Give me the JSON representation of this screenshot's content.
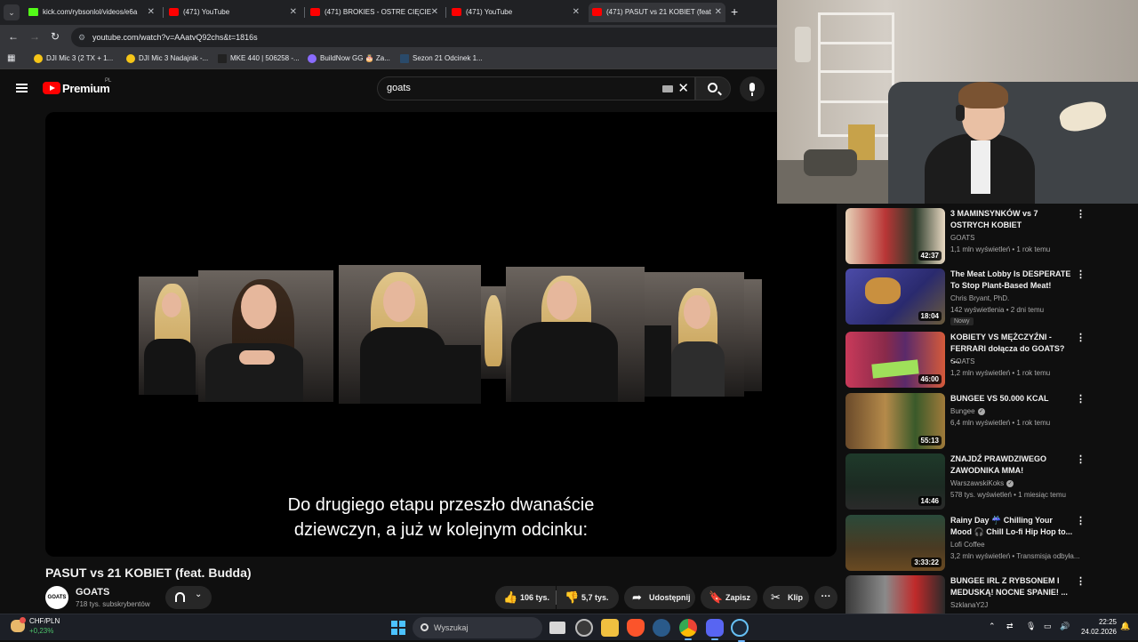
{
  "browser": {
    "tabs": [
      {
        "title": "kick.com/rybsonlol/videos/e6a",
        "favicon": "kick-icon",
        "active": false
      },
      {
        "title": "(471) YouTube",
        "favicon": "youtube-icon",
        "active": false
      },
      {
        "title": "(471) BROKIES - OSTRE CIĘCIE",
        "favicon": "youtube-icon",
        "active": false
      },
      {
        "title": "(471) YouTube",
        "favicon": "youtube-icon",
        "active": false
      },
      {
        "title": "(471) PASUT vs 21 KOBIET (feat",
        "favicon": "youtube-icon",
        "active": true
      }
    ],
    "url": "youtube.com/watch?v=AAatvQ92chs&t=1816s",
    "bookmarks": [
      {
        "label": "DJI Mic 3 (2 TX + 1...",
        "color": "#f5c518"
      },
      {
        "label": "DJI Mic 3 Nadajnik -...",
        "color": "#f5c518"
      },
      {
        "label": "MKE 440 | 506258 -...",
        "color": "#222222"
      },
      {
        "label": "BuildNow GG 🎂 Za...",
        "color": "#8a6cff"
      },
      {
        "label": "Sezon 21 Odcinek 1...",
        "color": "#2a4a6a"
      }
    ]
  },
  "youtube": {
    "brand": "Premium",
    "region": "PL",
    "search_query": "goats"
  },
  "video": {
    "subtitle_line1": "Do drugiego etapu przeszło dwanaście",
    "subtitle_line2": "dziewczyn, a już w kolejnym odcinku:",
    "title": "PASUT vs 21 KOBIET (feat. Budda)",
    "channel": {
      "name": "GOATS",
      "avatar_text": "GOATS",
      "subscribers": "718 tys. subskrybentów"
    },
    "actions": {
      "likes": "106 tys.",
      "dislikes": "5,7 tys.",
      "share": "Udostępnij",
      "save": "Zapisz",
      "clip": "Klip"
    }
  },
  "recommendations": [
    {
      "title": "3 MAMINSYNKÓW vs 7 OSTRYCH KOBIET",
      "channel": "GOATS",
      "meta": "1,1 mln wyświetleń • 1 rok temu",
      "duration": "42:37",
      "verified": false,
      "badge": ""
    },
    {
      "title": "The Meat Lobby Is DESPERATE To Stop Plant-Based Meat!",
      "channel": "Chris Bryant, PhD.",
      "meta": "142 wyświetlenia • 2 dni temu",
      "duration": "18:04",
      "verified": false,
      "badge": "Nowy"
    },
    {
      "title": "KOBIETY VS MĘŻCZYŹNI - FERRARI dołącza do GOATS? -...",
      "channel": "GOATS",
      "meta": "1,2 mln wyświetleń • 1 rok temu",
      "duration": "46:00",
      "verified": false,
      "badge": ""
    },
    {
      "title": "BUNGEE VS 50.000 KCAL",
      "channel": "Bungee",
      "meta": "6,4 mln wyświetleń • 1 rok temu",
      "duration": "55:13",
      "verified": true,
      "badge": ""
    },
    {
      "title": "ZNAJDŹ PRAWDZIWEGO ZAWODNIKA MMA!",
      "channel": "WarszawskiKoks",
      "meta": "578 tys. wyświetleń • 1 miesiąc temu",
      "duration": "14:46",
      "verified": true,
      "badge": ""
    },
    {
      "title": "Rainy Day ☔ Chilling Your Mood 🎧 Chill Lo-fi Hip Hop to...",
      "channel": "Lofi Coffee",
      "meta": "3,2 mln wyświetleń • Transmisja odbyła...",
      "duration": "3:33:22",
      "verified": false,
      "badge": ""
    },
    {
      "title": "BUNGEE IRL Z RYBSONEM I MEDUSKĄ! NOCNE SPANIE! ...",
      "channel": "SzklanaY2J",
      "meta": "",
      "duration": "",
      "verified": false,
      "badge": ""
    }
  ],
  "taskbar": {
    "ticker_name": "CHF/PLN",
    "ticker_value": "+0,23%",
    "search_placeholder": "Wyszukaj",
    "time": "22:25",
    "date": "24.02.2026"
  }
}
